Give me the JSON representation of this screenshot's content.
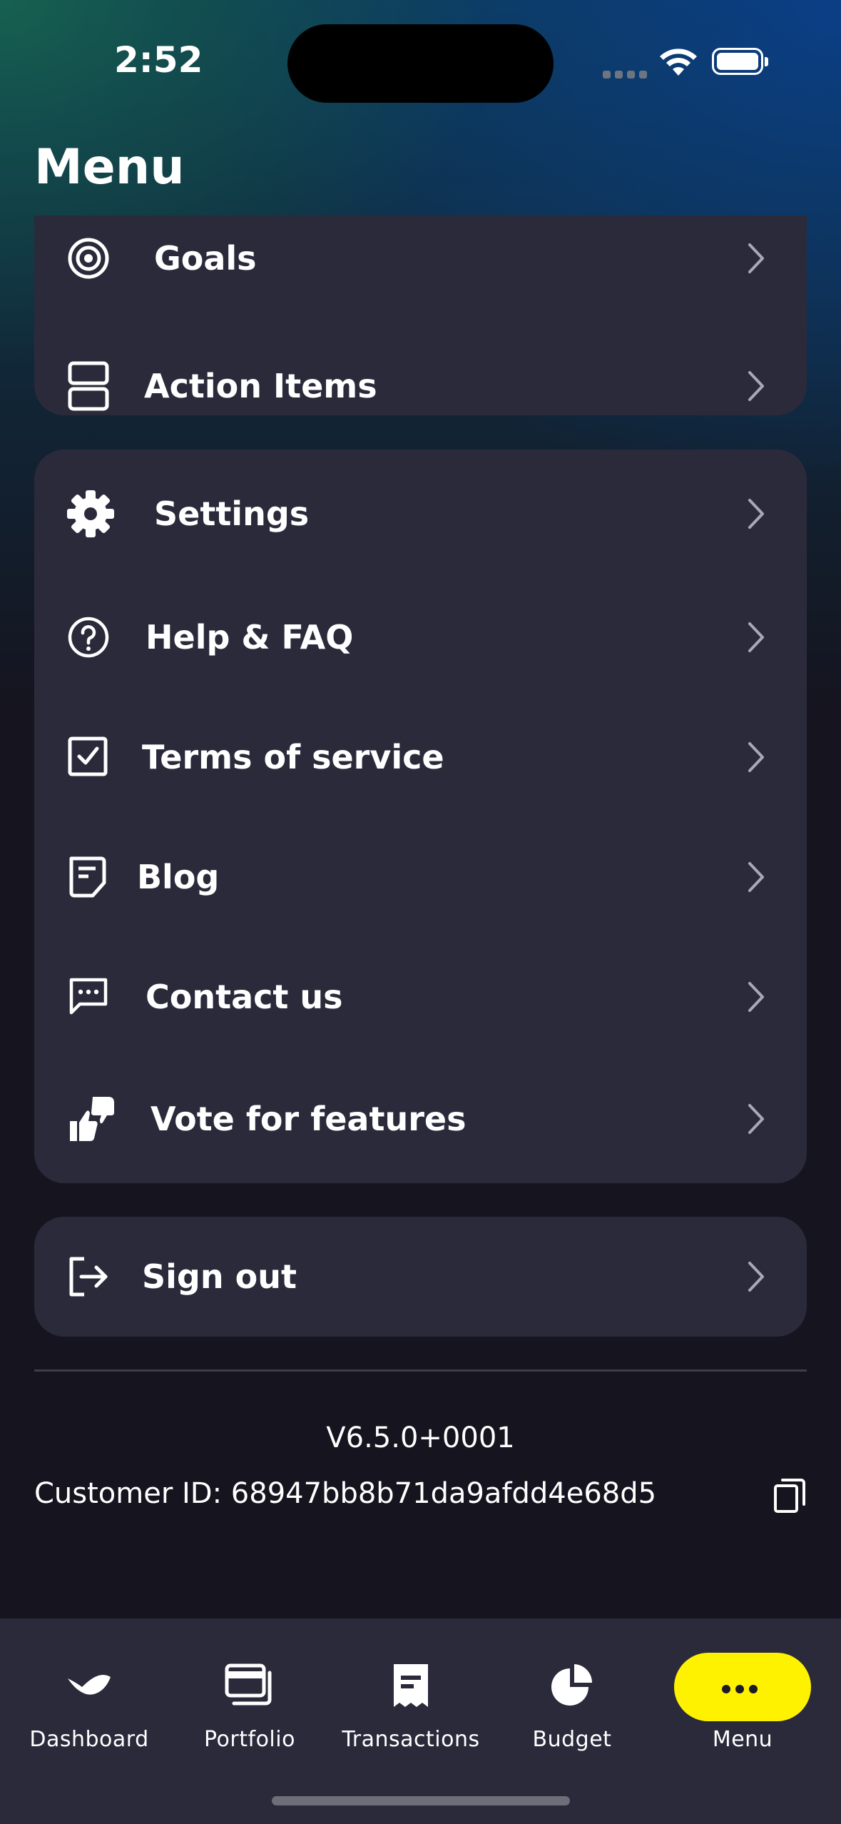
{
  "status_bar": {
    "time": "2:52"
  },
  "header": {
    "title": "Menu"
  },
  "card1_items": [
    {
      "label": "Goals",
      "icon": "target-icon"
    },
    {
      "label": "Action Items",
      "icon": "action-items-icon"
    }
  ],
  "card2_items": [
    {
      "label": "Settings",
      "icon": "gear-icon"
    },
    {
      "label": "Help & FAQ",
      "icon": "help-circle-icon"
    },
    {
      "label": "Terms of service",
      "icon": "checkbox-icon"
    },
    {
      "label": "Blog",
      "icon": "document-icon"
    },
    {
      "label": "Contact us",
      "icon": "chat-bubble-icon"
    },
    {
      "label": "Vote for features",
      "icon": "thumbs-up-down-icon"
    }
  ],
  "sign_out": {
    "label": "Sign out",
    "icon": "sign-out-icon"
  },
  "footer": {
    "version": "V6.5.0+0001",
    "customer_id": "Customer ID: 68947bb8b71da9afdd4e68d5"
  },
  "tabbar": {
    "tabs": [
      {
        "label": "Dashboard",
        "icon": "dashboard-icon"
      },
      {
        "label": "Portfolio",
        "icon": "portfolio-icon"
      },
      {
        "label": "Transactions",
        "icon": "receipt-icon"
      },
      {
        "label": "Budget",
        "icon": "pie-chart-icon"
      },
      {
        "label": "Menu",
        "icon": "more-dots-icon",
        "active": true
      }
    ],
    "accent_color": "#fff200"
  },
  "colors": {
    "background": "#15141f",
    "card": "#2b2a3b",
    "chevron": "#a9a8b6"
  }
}
